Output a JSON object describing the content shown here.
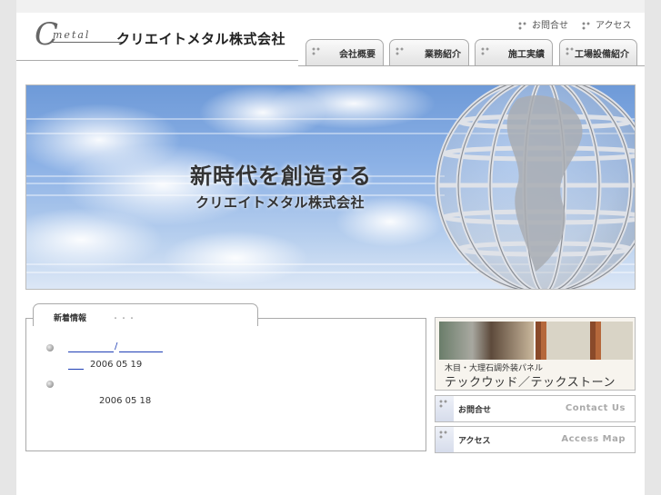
{
  "header": {
    "logo_letter": "C",
    "logo_word": "metal",
    "company_name": "クリエイトメタル株式会社",
    "utility_links": [
      {
        "label": "お問合せ"
      },
      {
        "label": "アクセス"
      }
    ],
    "nav_tabs": [
      {
        "label": "会社概要"
      },
      {
        "label": "業務紹介"
      },
      {
        "label": "施工実績"
      },
      {
        "label": "工場設備紹介"
      }
    ]
  },
  "banner": {
    "tagline": "新時代を創造する",
    "subtitle": "クリエイトメタル株式会社"
  },
  "news": {
    "heading": "新着情報",
    "heading_dots": "・・・",
    "items": [
      {
        "slash": "/",
        "date": "2006 05 19"
      },
      {
        "date": "2006 05 18"
      }
    ]
  },
  "sidebar": {
    "promo": {
      "caption": "木目・大理石調外装パネル",
      "title": "テックウッド／テックストーン"
    },
    "buttons": [
      {
        "label_jp": "お問合せ",
        "label_en": "Contact Us"
      },
      {
        "label_jp": "アクセス",
        "label_en": "Access Map"
      }
    ]
  },
  "colors": {
    "link": "#1f3fb5",
    "background": "#e6e6e6"
  }
}
